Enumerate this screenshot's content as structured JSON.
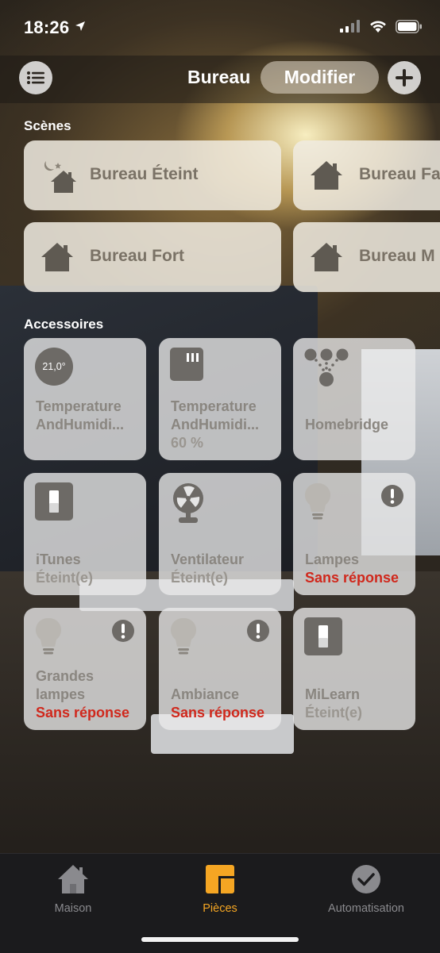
{
  "status_bar": {
    "time": "18:26",
    "icons": [
      "location-arrow-icon",
      "cellular-signal-icon",
      "wifi-icon",
      "battery-icon"
    ]
  },
  "header": {
    "room": "Bureau",
    "modify_label": "Modifier"
  },
  "scenes": {
    "title": "Scènes",
    "items": [
      {
        "name": "Bureau Éteint",
        "icon": "night-home-icon"
      },
      {
        "name": "Bureau Fa",
        "icon": "home-icon"
      },
      {
        "name": "Bureau Fort",
        "icon": "home-icon"
      },
      {
        "name": "Bureau M",
        "icon": "home-icon"
      }
    ]
  },
  "accessories": {
    "title": "Accessoires",
    "items": [
      {
        "name1": "Temperature",
        "name2": "AndHumidi...",
        "status": "",
        "badge": "21,0°",
        "icon": "thermometer-badge-icon"
      },
      {
        "name1": "Temperature",
        "name2": "AndHumidi...",
        "status": "60 %",
        "icon": "humidity-sensor-icon"
      },
      {
        "name1": "Homebridge",
        "name2": "",
        "status": "",
        "icon": "bridge-hub-icon"
      },
      {
        "name1": "iTunes",
        "name2": "",
        "status": "Éteint(e)",
        "icon": "switch-icon"
      },
      {
        "name1": "Ventilateur",
        "name2": "",
        "status": "Éteint(e)",
        "icon": "fan-icon"
      },
      {
        "name1": "Lampes",
        "name2": "",
        "status": "Sans réponse",
        "icon": "lightbulb-icon",
        "warning": true
      },
      {
        "name1": "Grandes",
        "name2": "lampes",
        "status": "Sans réponse",
        "icon": "lightbulb-icon",
        "warning": true
      },
      {
        "name1": "Ambiance",
        "name2": "",
        "status": "Sans réponse",
        "icon": "lightbulb-icon",
        "warning": true
      },
      {
        "name1": "MiLearn",
        "name2": "",
        "status": "Éteint(e)",
        "icon": "switch-icon"
      }
    ]
  },
  "tabbar": {
    "tabs": [
      {
        "label": "Maison",
        "icon": "house-icon",
        "selected": false
      },
      {
        "label": "Pièces",
        "icon": "rooms-icon",
        "selected": true
      },
      {
        "label": "Automatisation",
        "icon": "automation-clock-icon",
        "selected": false
      }
    ]
  },
  "colors": {
    "accent": "#f5a623",
    "alert": "#d0281c",
    "tabbar": "#1b1b1d"
  }
}
